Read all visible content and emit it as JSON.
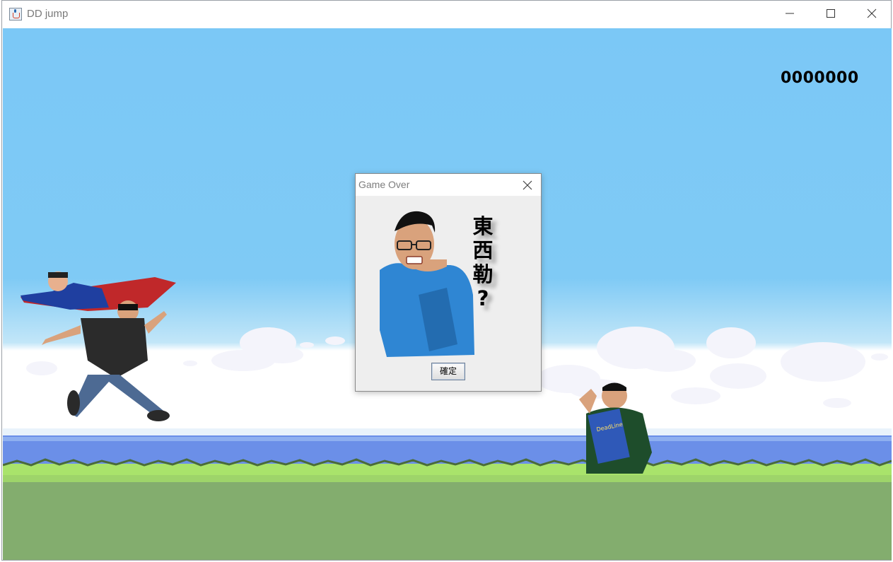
{
  "window": {
    "title": "DD jump",
    "controls": {
      "minimize_icon": "minimize-icon",
      "maximize_icon": "maximize-icon",
      "close_icon": "close-icon"
    }
  },
  "game": {
    "score": "0000000",
    "colors": {
      "sky": "#7bc8f6",
      "sea": "#6b8fe8",
      "grass_top": "#a9e36b",
      "ground": "#83ad6e"
    }
  },
  "dialog": {
    "title": "Game Over",
    "message_chars": [
      "東",
      "西",
      "勒",
      "?"
    ],
    "ok_label": "確定"
  }
}
